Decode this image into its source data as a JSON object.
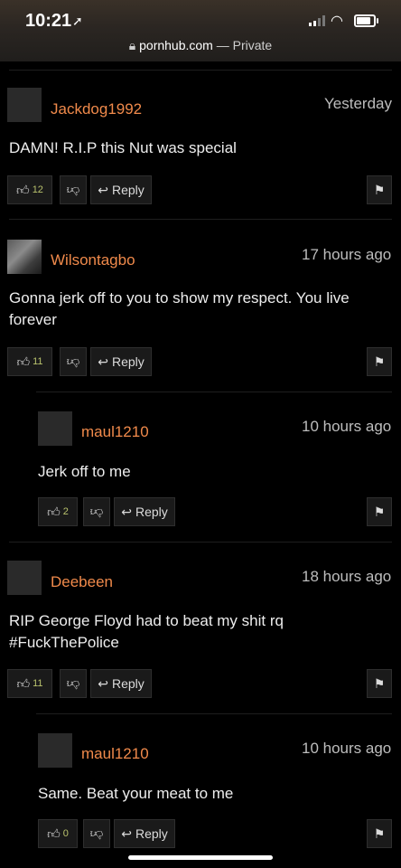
{
  "status": {
    "time": "10:21",
    "url_domain": "pornhub.com",
    "url_suffix": " — Private"
  },
  "comments": [
    {
      "username": "Jackdog1992",
      "timestamp": "Yesterday",
      "text": "DAMN! R.I.P this Nut was special",
      "upvotes": "12",
      "reply_label": "Reply"
    },
    {
      "username": "Wilsontagbo",
      "timestamp": "17 hours ago",
      "text": "Gonna jerk off to you to show my respect. You live forever",
      "upvotes": "11",
      "reply_label": "Reply"
    },
    {
      "username": "maul1210",
      "timestamp": "10 hours ago",
      "text": "Jerk off to me",
      "upvotes": "2",
      "reply_label": "Reply"
    },
    {
      "username": "Deebeen",
      "timestamp": "18 hours ago",
      "text": "RIP George Floyd had to beat my shit rq #FuckThePolice",
      "upvotes": "11",
      "reply_label": "Reply"
    },
    {
      "username": "maul1210",
      "timestamp": "10 hours ago",
      "text": "Same. Beat your meat to me",
      "upvotes": "0",
      "reply_label": "Reply"
    }
  ],
  "colors": {
    "username": "#f08a4b",
    "upvote_count": "#b9c26d",
    "background": "#000000"
  }
}
